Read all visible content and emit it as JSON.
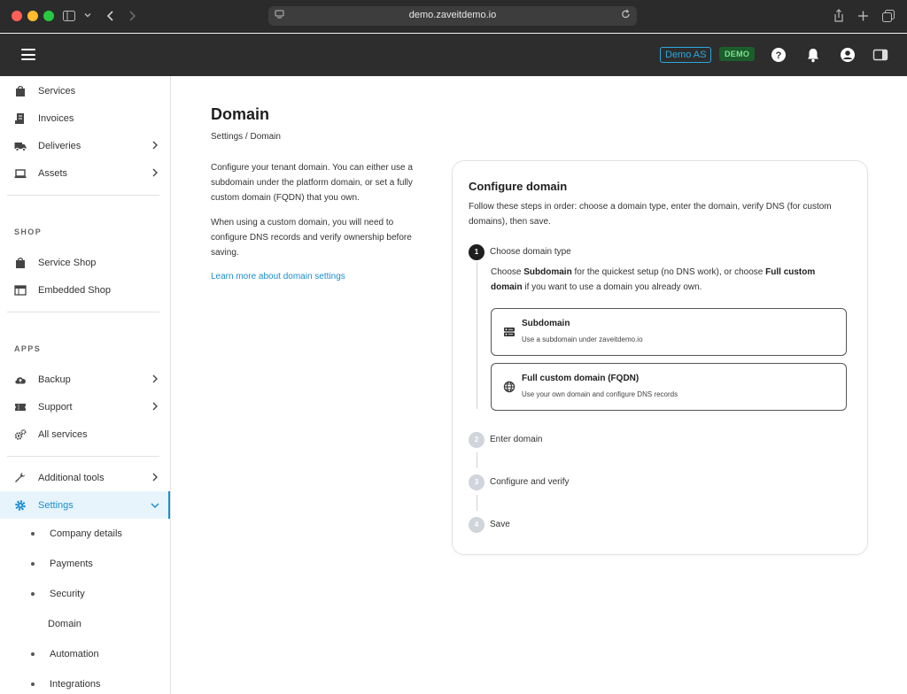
{
  "browser": {
    "url": "demo.zaveitdemo.io"
  },
  "header": {
    "tenant_badge": "Demo AS",
    "env_badge": "DEMO"
  },
  "sidebar": {
    "items_top": [
      {
        "label": "Services",
        "icon": "bag-icon"
      },
      {
        "label": "Invoices",
        "icon": "invoice-icon"
      },
      {
        "label": "Deliveries",
        "icon": "truck-icon"
      },
      {
        "label": "Assets",
        "icon": "laptop-icon"
      }
    ],
    "shop_title": "SHOP",
    "shop_items": [
      {
        "label": "Service Shop",
        "icon": "bag-icon"
      },
      {
        "label": "Embedded Shop",
        "icon": "window-icon"
      }
    ],
    "apps_title": "APPS",
    "apps_items": [
      {
        "label": "Backup",
        "icon": "cloud-upload-icon"
      },
      {
        "label": "Support",
        "icon": "ticket-icon"
      },
      {
        "label": "All services",
        "icon": "gears-icon"
      }
    ],
    "tools_items": [
      {
        "label": "Additional tools",
        "icon": "wrench-icon"
      },
      {
        "label": "Settings",
        "icon": "gear-icon"
      }
    ],
    "settings_sub": [
      {
        "label": "Company details"
      },
      {
        "label": "Payments"
      },
      {
        "label": "Security"
      },
      {
        "label": "Domain"
      },
      {
        "label": "Automation"
      },
      {
        "label": "Integrations"
      }
    ],
    "accent_color": "#1b8ecf"
  },
  "main": {
    "title": "Domain",
    "breadcrumb": "Settings / Domain",
    "desc_1": "Configure your tenant domain. You can either use a subdomain under the platform domain, or set a fully custom domain (FQDN) that you own.",
    "desc_2": "When using a custom domain, you will need to configure DNS records and verify ownership before saving.",
    "learn_more": "Learn more about domain settings"
  },
  "card": {
    "title": "Configure domain",
    "subtitle": "Follow these steps in order: choose a domain type, enter the domain, verify DNS (for custom domains), then save.",
    "steps": [
      {
        "num": "1",
        "label": "Choose domain type"
      },
      {
        "num": "2",
        "label": "Enter domain"
      },
      {
        "num": "3",
        "label": "Configure and verify"
      },
      {
        "num": "4",
        "label": "Save"
      }
    ],
    "step1_desc": {
      "p1": "Choose ",
      "b1": "Subdomain",
      "p2": " for the quickest setup (no DNS work), or choose ",
      "b2": "Full custom domain",
      "p3": " if you want to use a domain you already own."
    },
    "options": [
      {
        "title": "Subdomain",
        "subtitle": "Use a subdomain under zaveitdemo.io",
        "icon": "server-icon"
      },
      {
        "title": "Full custom domain (FQDN)",
        "subtitle": "Use your own domain and configure DNS records",
        "icon": "globe-icon"
      }
    ]
  }
}
